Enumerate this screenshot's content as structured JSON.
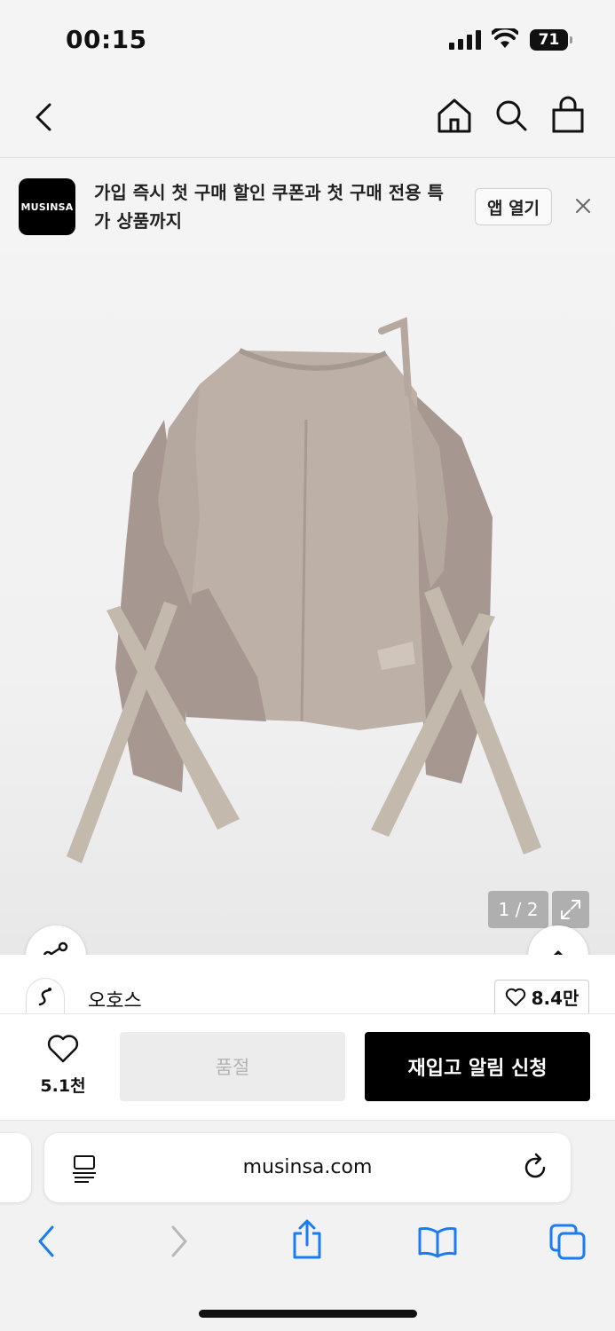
{
  "status_bar": {
    "time": "00:15",
    "battery": "71"
  },
  "nav": {
    "icons": [
      "back-chevron-icon",
      "home-icon",
      "search-icon",
      "shopping-bag-icon"
    ]
  },
  "banner": {
    "logo_text": "MUSINSA",
    "message": "가입 즉시 첫 구매 할인 쿠폰과 첫 구매 전용 특가 상품까지",
    "open_app_label": "앱 열기"
  },
  "gallery": {
    "pager": "1 / 2"
  },
  "brand": {
    "name": "오호스",
    "likes": "8.4만"
  },
  "actions": {
    "wish_count": "5.1천",
    "soldout_label": "품절",
    "restock_label": "재입고 알림 신청"
  },
  "browser": {
    "url": "musinsa.com"
  },
  "colors": {
    "restock_bg": "#000000",
    "soldout_bg": "#ececec",
    "link_blue": "#1a7cf2"
  }
}
